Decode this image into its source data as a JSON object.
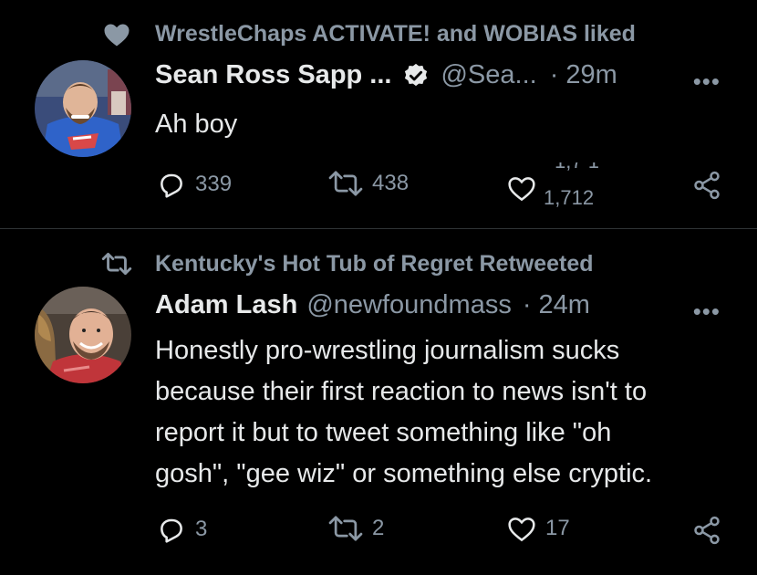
{
  "tweets": [
    {
      "social_context": "WrestleChaps ACTIVATE! and WOBIAS liked",
      "social_icon": "heart-icon",
      "author_name": "Sean Ross Sapp ...",
      "verified": true,
      "handle": "@Sea...",
      "separator": "·",
      "time": "29m",
      "more": "•••",
      "text": "Ah boy",
      "replies": "339",
      "retweets": "438",
      "likes_old": "1,7 1",
      "likes": "1,712"
    },
    {
      "social_context": "Kentucky's Hot Tub of Regret Retweeted",
      "social_icon": "retweet-icon",
      "author_name": "Adam Lash",
      "handle": "@newfoundmass",
      "separator": "·",
      "time": "24m",
      "more": "•••",
      "text_lines": [
        "Honestly pro-wrestling journalism sucks",
        "because their first reaction to news isn't to",
        "report it but to tweet something like \"oh",
        "gosh\", \"gee wiz\" or something else cryptic."
      ],
      "replies": "3",
      "retweets": "2",
      "likes": "17"
    }
  ],
  "colors": {
    "background": "#000000",
    "text": "#e7e9ea",
    "muted": "#8b98a5",
    "divider": "#2f3336"
  }
}
